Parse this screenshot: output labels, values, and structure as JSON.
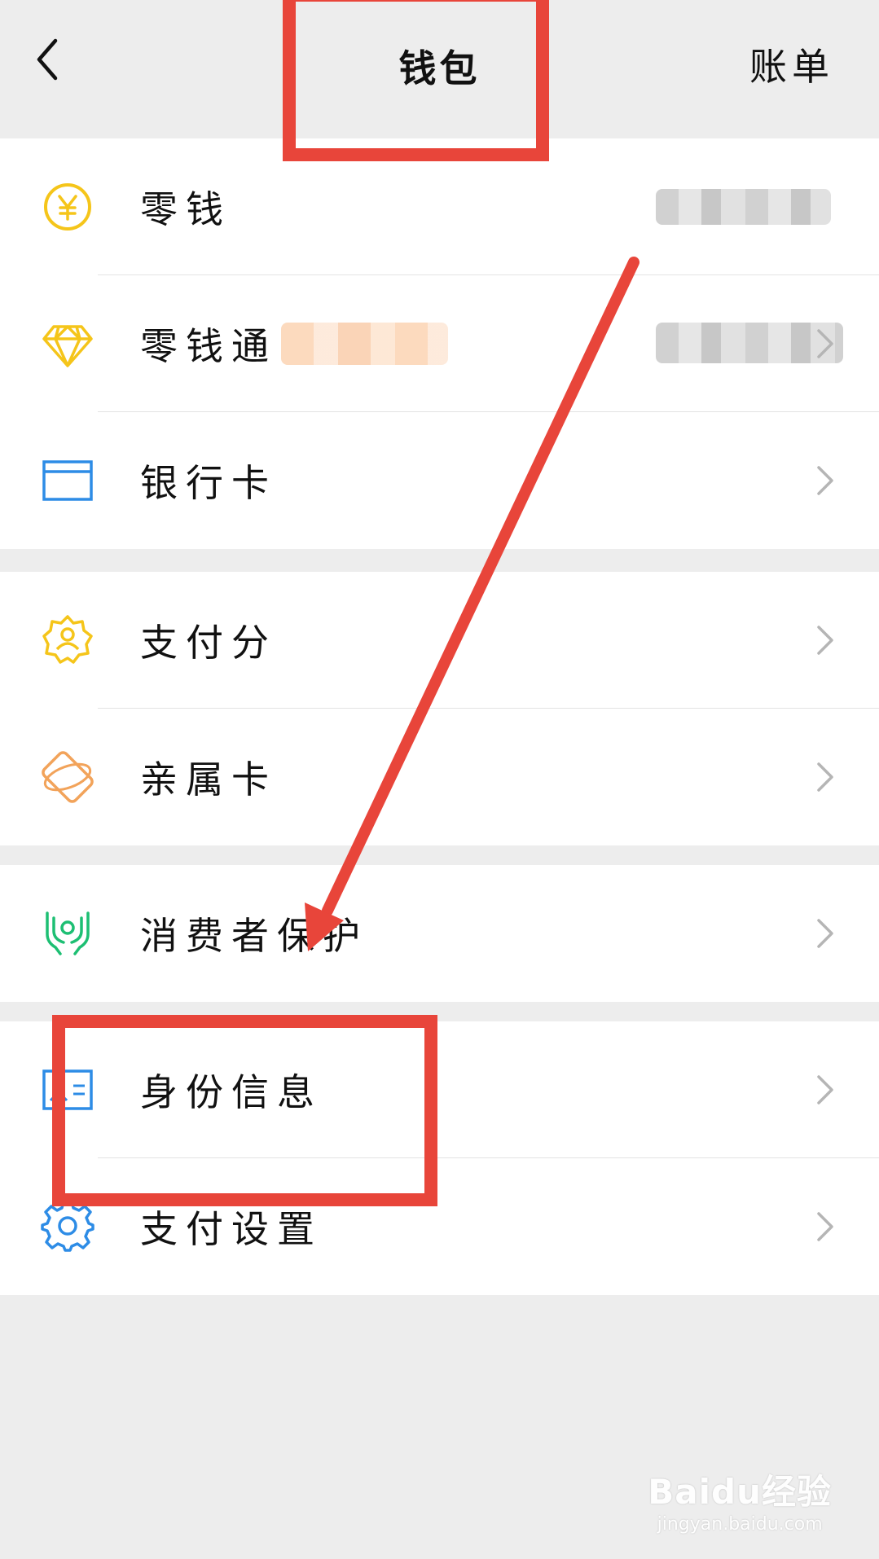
{
  "header": {
    "title": "钱包",
    "bill_label": "账单"
  },
  "groups": [
    {
      "items": [
        {
          "label": "零钱",
          "icon": "yuan-coin-icon",
          "value": "blurred"
        },
        {
          "label": "零钱通",
          "icon": "diamond-icon",
          "value": "blurred"
        },
        {
          "label": "银行卡",
          "icon": "bank-card-icon"
        }
      ]
    },
    {
      "items": [
        {
          "label": "支付分",
          "icon": "pay-score-badge-icon"
        },
        {
          "label": "亲属卡",
          "icon": "family-card-icon"
        }
      ]
    },
    {
      "items": [
        {
          "label": "消费者保护",
          "icon": "protection-hands-icon"
        }
      ]
    },
    {
      "items": [
        {
          "label": "身份信息",
          "icon": "id-card-icon"
        },
        {
          "label": "支付设置",
          "icon": "gear-icon"
        }
      ]
    }
  ],
  "watermark": {
    "main": "Baidu经验",
    "sub": "jingyan.baidu.com"
  },
  "colors": {
    "background": "#ededed",
    "annotation_red": "#e8453a",
    "yellow": "#f5c51a",
    "blue": "#2d8ce6",
    "orange": "#f2a35a",
    "green": "#1dbf73"
  }
}
